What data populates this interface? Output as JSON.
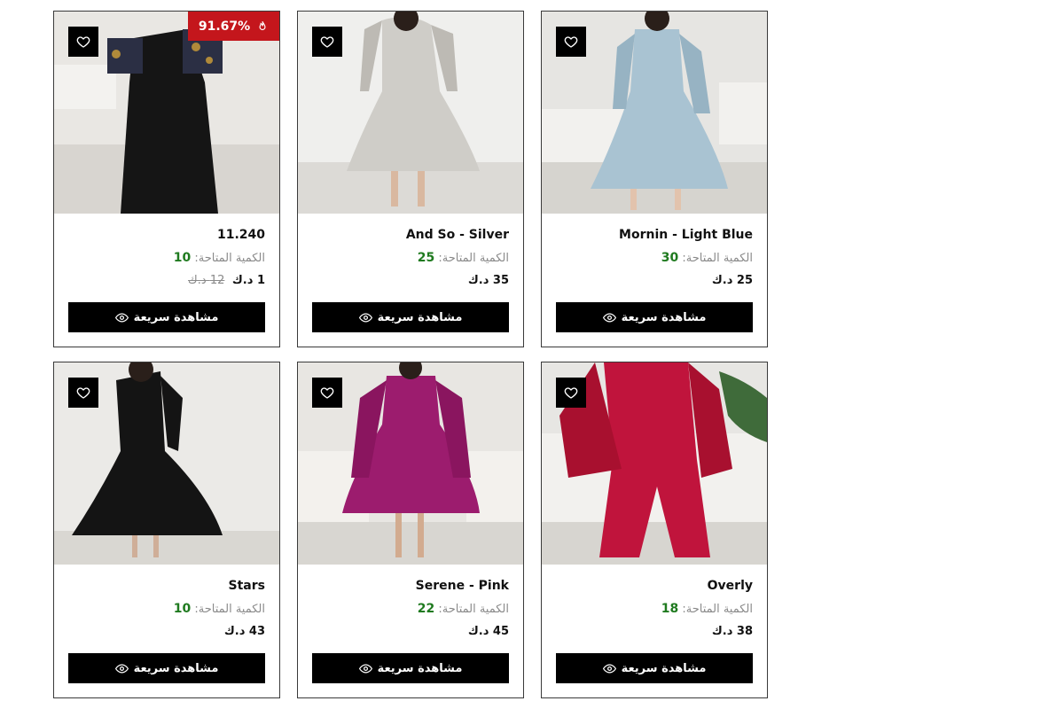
{
  "wishlist_icon": "heart-outline-icon",
  "quick_view_icon": "eye-icon",
  "colors": {
    "quantity_green": "#1f7a1f",
    "discount_red": "#c4161c",
    "button_black": "#000000"
  },
  "products": [
    {
      "name": "11.240",
      "qty_label": "الكمية المتاحة:",
      "qty_value": "10",
      "price": "1 د.ك",
      "old_price": "12 د.ك",
      "discount": "91.67%",
      "discount_icon": "fire-icon",
      "button_label": "مشاهدة سريعة"
    },
    {
      "name": "And So - Silver",
      "qty_label": "الكمية المتاحة:",
      "qty_value": "25",
      "price": "35 د.ك",
      "button_label": "مشاهدة سريعة"
    },
    {
      "name": "Mornin - Light Blue",
      "qty_label": "الكمية المتاحة:",
      "qty_value": "30",
      "price": "25 د.ك",
      "button_label": "مشاهدة سريعة"
    },
    {
      "name": "Stars",
      "qty_label": "الكمية المتاحة:",
      "qty_value": "10",
      "price": "43 د.ك",
      "button_label": "مشاهدة سريعة"
    },
    {
      "name": "Serene - Pink",
      "qty_label": "الكمية المتاحة:",
      "qty_value": "22",
      "price": "45 د.ك",
      "button_label": "مشاهدة سريعة"
    },
    {
      "name": "Overly",
      "qty_label": "الكمية المتاحة:",
      "qty_value": "18",
      "price": "38 د.ك",
      "button_label": "مشاهدة سريعة"
    }
  ]
}
